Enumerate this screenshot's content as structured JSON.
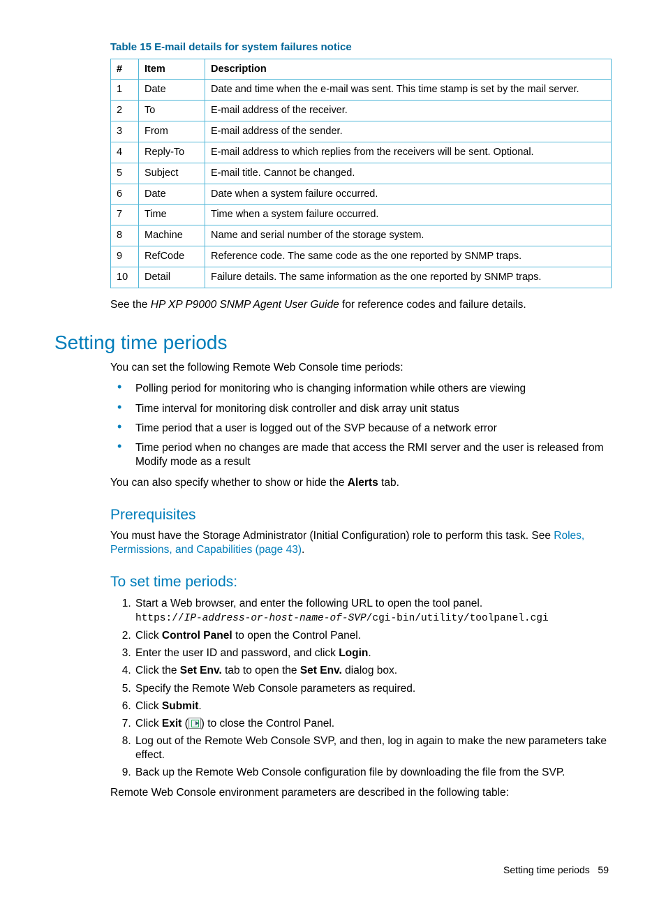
{
  "table": {
    "caption": "Table 15 E-mail details for system failures notice",
    "headers": [
      "#",
      "Item",
      "Description"
    ],
    "rows": [
      {
        "n": "1",
        "item": "Date",
        "desc": "Date and time when the e-mail was sent. This time stamp is set by the mail server."
      },
      {
        "n": "2",
        "item": "To",
        "desc": "E-mail address of the receiver."
      },
      {
        "n": "3",
        "item": "From",
        "desc": "E-mail address of the sender."
      },
      {
        "n": "4",
        "item": "Reply-To",
        "desc": "E-mail address to which replies from the receivers will be sent. Optional."
      },
      {
        "n": "5",
        "item": "Subject",
        "desc": "E-mail title. Cannot be changed."
      },
      {
        "n": "6",
        "item": "Date",
        "desc": "Date when a system failure occurred."
      },
      {
        "n": "7",
        "item": "Time",
        "desc": "Time when a system failure occurred."
      },
      {
        "n": "8",
        "item": "Machine",
        "desc": "Name and serial number of the storage system."
      },
      {
        "n": "9",
        "item": "RefCode",
        "desc": "Reference code. The same code as the one reported by SNMP traps."
      },
      {
        "n": "10",
        "item": "Detail",
        "desc": "Failure details. The same information as the one reported by SNMP traps."
      }
    ]
  },
  "note": {
    "pre": "See the ",
    "em": "HP XP P9000 SNMP Agent User Guide",
    "post": " for reference codes and failure details."
  },
  "h1": "Setting time periods",
  "intro": "You can set the following Remote Web Console time periods:",
  "bullets": [
    "Polling period for monitoring who is changing information while others are viewing",
    "Time interval for monitoring disk controller and disk array unit status",
    "Time period that a user is logged out of the SVP because of a network error",
    "Time period when no changes are made that access the RMI server and the user is released from Modify mode as a result"
  ],
  "alerts": {
    "pre": "You can also specify whether to show or hide the ",
    "bold": "Alerts",
    "post": " tab."
  },
  "h2_prereq": "Prerequisites",
  "prereq": {
    "pre": "You must have the Storage Administrator (Initial Configuration) role to perform this task. See ",
    "link": "Roles, Permissions, and Capabilities (page 43)",
    "post": "."
  },
  "h2_steps": "To set time periods:",
  "step1": {
    "text": "Start a Web browser, and enter the following URL to open the tool panel.",
    "url_pre": "https://",
    "url_em": "IP-address-or-host-name-of-SVP",
    "url_post": "/cgi-bin/utility/toolpanel.cgi"
  },
  "step2": {
    "pre": "Click ",
    "b": "Control Panel",
    "post": " to open the Control Panel."
  },
  "step3": {
    "pre": "Enter the user ID and password, and click ",
    "b": "Login",
    "post": "."
  },
  "step4": {
    "pre": "Click the ",
    "b1": "Set Env.",
    "mid": " tab to open the ",
    "b2": "Set Env.",
    "post": " dialog box."
  },
  "step5": "Specify the Remote Web Console parameters as required.",
  "step6": {
    "pre": "Click ",
    "b": "Submit",
    "post": "."
  },
  "step7": {
    "pre": "Click ",
    "b": "Exit",
    "post": ") to close the Control Panel.",
    "paren": " ("
  },
  "step8": "Log out of the Remote Web Console SVP, and then, log in again to make the new parameters take effect.",
  "step9": "Back up the Remote Web Console configuration file by downloading the file from the SVP.",
  "outro": "Remote Web Console environment parameters are described in the following table:",
  "footer": {
    "label": "Setting time periods",
    "page": "59"
  }
}
